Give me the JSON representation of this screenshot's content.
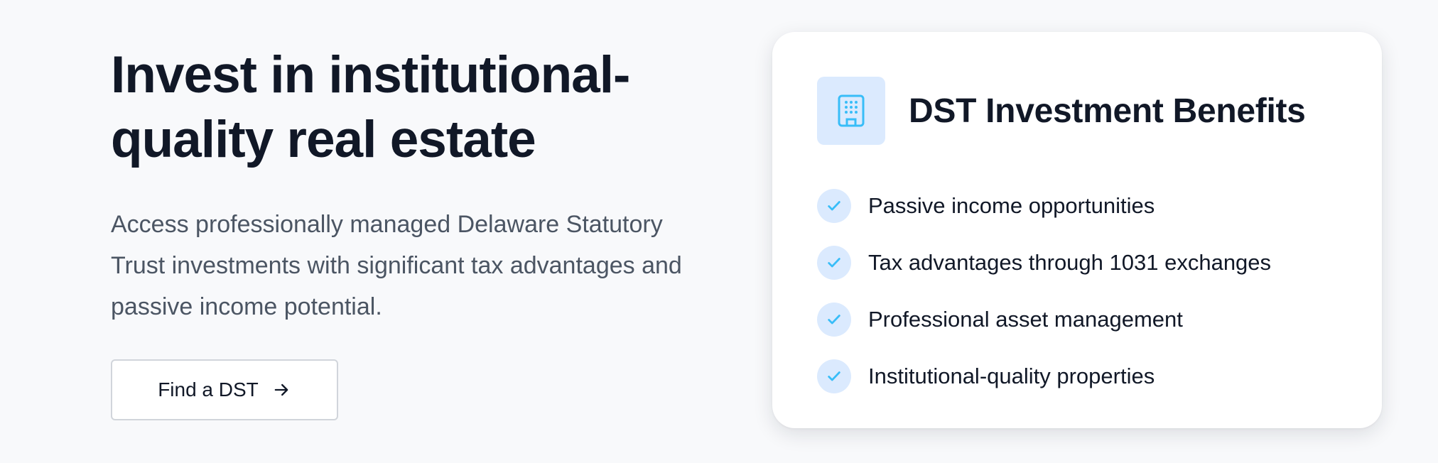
{
  "hero": {
    "title_line1": "Invest in institutional-",
    "title_line2": "quality real estate",
    "description_line1": "Access professionally managed Delaware Statutory",
    "description_line2": "Trust investments with significant tax advantages and",
    "description_line3": "passive income potential.",
    "cta_label": "Find a DST",
    "cta_icon": "arrow-right-icon"
  },
  "card": {
    "icon": "building-icon",
    "title": "DST Investment Benefits",
    "benefits": [
      {
        "icon": "check-icon",
        "label": "Passive income opportunities"
      },
      {
        "icon": "check-icon",
        "label": "Tax advantages through 1031 exchanges"
      },
      {
        "icon": "check-icon",
        "label": "Professional asset management"
      },
      {
        "icon": "check-icon",
        "label": "Institutional-quality properties"
      }
    ]
  },
  "colors": {
    "page_background": "#f8f9fb",
    "heading": "#111827",
    "body_text": "#4b5563",
    "accent": "#38bdf8",
    "icon_background": "#dbeafe",
    "button_border": "#d1d5db"
  }
}
